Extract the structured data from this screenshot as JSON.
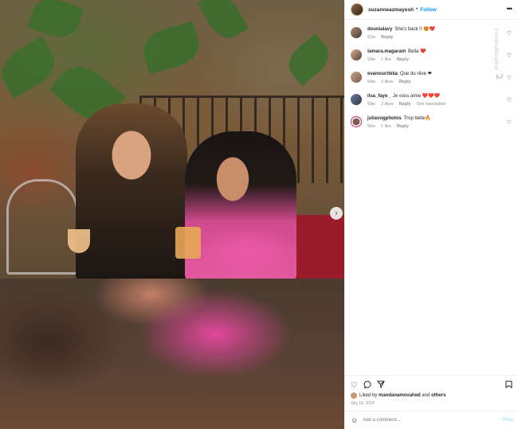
{
  "post": {
    "username": "suzanneazmayesh",
    "follow_label": "Follow",
    "more_icon": "more-horizontal-icon"
  },
  "comments": [
    {
      "user": "dounialavy",
      "text": "She's back !! 😍❤️",
      "time": "52w",
      "likes": "",
      "reply": "Reply",
      "translation": ""
    },
    {
      "user": "tamara.magaram",
      "text": "Bella ❤️",
      "time": "59w",
      "likes": "1 like",
      "reply": "Reply",
      "translation": ""
    },
    {
      "user": "evanouchkka",
      "text": "Que du rêve ❤",
      "time": "58w",
      "likes": "2 likes",
      "reply": "Reply",
      "translation": ""
    },
    {
      "user": "lisa_faye_",
      "text": "Je vous aime ❤️❤️❤️",
      "time": "59w",
      "likes": "2 likes",
      "reply": "Reply",
      "translation": "See translation"
    },
    {
      "user": "juliavogphotos",
      "text": "Trop belle🔥",
      "time": "58w",
      "likes": "1 like",
      "reply": "Reply",
      "translation": ""
    }
  ],
  "watermark": {
    "logo": "ج",
    "text": "mashreghnews.ir"
  },
  "likes": {
    "prefix": "Liked by",
    "user": "mandanamovahed",
    "and": "and",
    "others": "others"
  },
  "date": "July 16, 2024",
  "comment_box": {
    "placeholder": "Add a comment...",
    "post_label": "Post"
  },
  "icons": {
    "like": "heart-icon",
    "comment": "comment-icon",
    "share": "share-icon",
    "save": "bookmark-icon",
    "emoji": "emoji-icon",
    "next": "chevron-right-icon"
  }
}
